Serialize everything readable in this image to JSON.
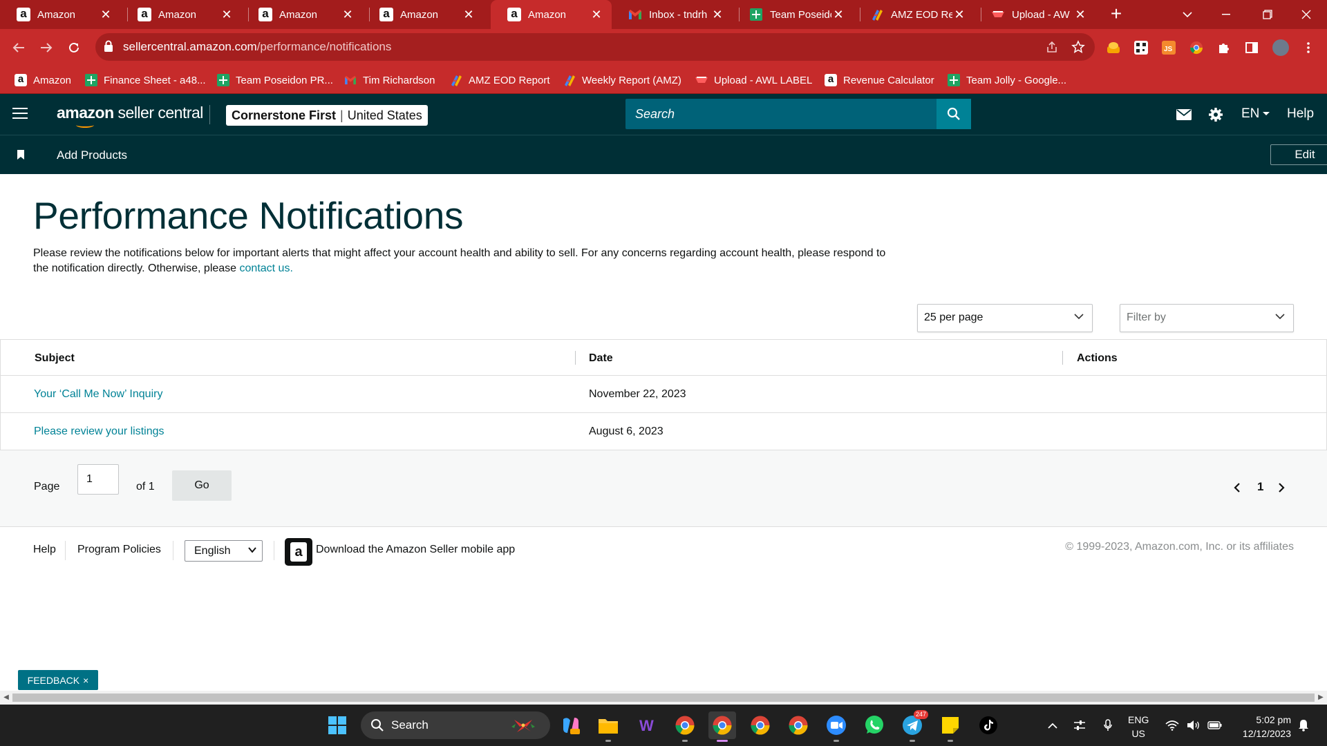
{
  "browser": {
    "tabs": [
      {
        "title": "Amazon",
        "favicon": "amazon-icon",
        "active": false
      },
      {
        "title": "Amazon",
        "favicon": "amazon-icon",
        "active": false
      },
      {
        "title": "Amazon",
        "favicon": "amazon-icon",
        "active": false
      },
      {
        "title": "Amazon",
        "favicon": "amazon-icon",
        "active": false
      },
      {
        "title": "Amazon",
        "favicon": "amazon-icon",
        "active": true
      },
      {
        "title": "Inbox - tndrh",
        "favicon": "gmail-icon",
        "active": false
      },
      {
        "title": "Team Poseido",
        "favicon": "sheets-icon",
        "active": false
      },
      {
        "title": "AMZ EOD Re",
        "favicon": "report-icon",
        "active": false
      },
      {
        "title": "Upload - AW",
        "favicon": "upload-icon",
        "active": false
      }
    ],
    "url_host": "sellercentral.amazon.com",
    "url_path": "/performance/notifications",
    "bookmarks": [
      {
        "label": "Amazon",
        "icon": "amazon-icon"
      },
      {
        "label": "Finance Sheet - a48...",
        "icon": "sheets-icon"
      },
      {
        "label": "Team Poseidon PR...",
        "icon": "sheets-icon"
      },
      {
        "label": "Tim Richardson",
        "icon": "gmail-icon"
      },
      {
        "label": "AMZ EOD Report",
        "icon": "report-icon"
      },
      {
        "label": "Weekly Report (AMZ)",
        "icon": "report-icon"
      },
      {
        "label": "Upload - AWL LABEL",
        "icon": "upload-icon"
      },
      {
        "label": "Revenue Calculator",
        "icon": "amazon-icon"
      },
      {
        "label": "Team Jolly - Google...",
        "icon": "sheets-icon"
      }
    ],
    "profile_initial": "i",
    "colors": {
      "frame": "#a31c1c",
      "toolbar": "#c62b2b"
    }
  },
  "header": {
    "logo_bold": "amazon",
    "logo_rest": " seller central",
    "store_name": "Cornerstone First",
    "store_region": "United States",
    "search_placeholder": "Search",
    "language": "EN",
    "help": "Help",
    "colors": {
      "nav_bg": "#002f36",
      "search_bg": "#006278",
      "accent": "#008296"
    }
  },
  "subnav": {
    "bookmark_label": "Add Products",
    "edit_label": "Edit"
  },
  "main": {
    "title": "Performance Notifications",
    "intro_text": "Please review the notifications below for important alerts that might affect your account health and ability to sell. For any concerns regarding account health, please respond to the notification directly. Otherwise, please ",
    "intro_link": "contact us.",
    "per_page": "25 per page",
    "filter_placeholder": "Filter by",
    "columns": [
      "Subject",
      "Date",
      "Actions"
    ],
    "rows": [
      {
        "subject": "Your ‘Call Me Now’ Inquiry",
        "date": "November 22, 2023"
      },
      {
        "subject": "Please review your listings",
        "date": "August 6, 2023"
      }
    ],
    "pagination": {
      "page_label": "Page",
      "page_value": "1",
      "of_label": "of 1",
      "go_label": "Go",
      "current": "1"
    }
  },
  "footer": {
    "links": [
      "Help",
      "Program Policies"
    ],
    "language_select": "English",
    "app_text": "Download the Amazon Seller mobile app",
    "copyright": "© 1999-2023, Amazon.com, Inc. or its affiliates"
  },
  "feedback": {
    "label": "FEEDBACK",
    "close": "×"
  },
  "taskbar": {
    "search_label": "Search",
    "lang_line1": "ENG",
    "lang_line2": "US",
    "time": "5:02 pm",
    "date": "12/12/2023",
    "telegram_badge": "247"
  }
}
